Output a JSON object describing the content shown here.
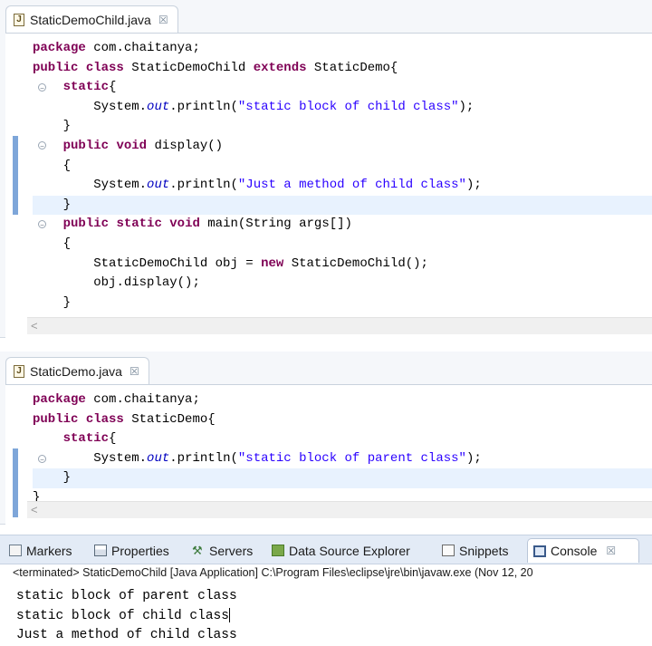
{
  "editor1": {
    "tab_title": "StaticDemoChild.java",
    "tab_close": "☒",
    "lines": [
      "package com.chaitanya;",
      "public class StaticDemoChild extends StaticDemo{",
      "    static{",
      "        System.out.println(\"static block of child class\");",
      "    }",
      "    public void display()",
      "    {",
      "        System.out.println(\"Just a method of child class\");",
      "    }",
      "    public static void main(String args[])",
      "    {",
      "        StaticDemoChild obj = new StaticDemoChild();",
      "        obj.display();",
      "    }"
    ],
    "scroll_arrow": "<"
  },
  "editor2": {
    "tab_title": "StaticDemo.java",
    "tab_close": "☒",
    "lines": [
      "package com.chaitanya;",
      "public class StaticDemo{",
      "    static{",
      "        System.out.println(\"static block of parent class\");",
      "    }",
      "}"
    ],
    "scroll_arrow": "<"
  },
  "console_view": {
    "tabs": [
      {
        "label": "Markers",
        "icon": "markers-icon"
      },
      {
        "label": "Properties",
        "icon": "properties-icon"
      },
      {
        "label": "Servers",
        "icon": "servers-icon"
      },
      {
        "label": "Data Source Explorer",
        "icon": "data-source-explorer-icon"
      },
      {
        "label": "Snippets",
        "icon": "snippets-icon"
      },
      {
        "label": "Console",
        "icon": "console-icon",
        "active": true
      }
    ],
    "console_close": "☒",
    "status": "<terminated> StaticDemoChild [Java Application] C:\\Program Files\\eclipse\\jre\\bin\\javaw.exe (Nov 12, 20",
    "output": [
      "static block of parent class",
      "static block of child class",
      "Just a method of child class"
    ]
  },
  "colors": {
    "keyword": "#7f0055",
    "string": "#2a00ff",
    "field": "#0000c0",
    "current_line": "#e8f2fe",
    "marker": "#7ea6d9"
  }
}
